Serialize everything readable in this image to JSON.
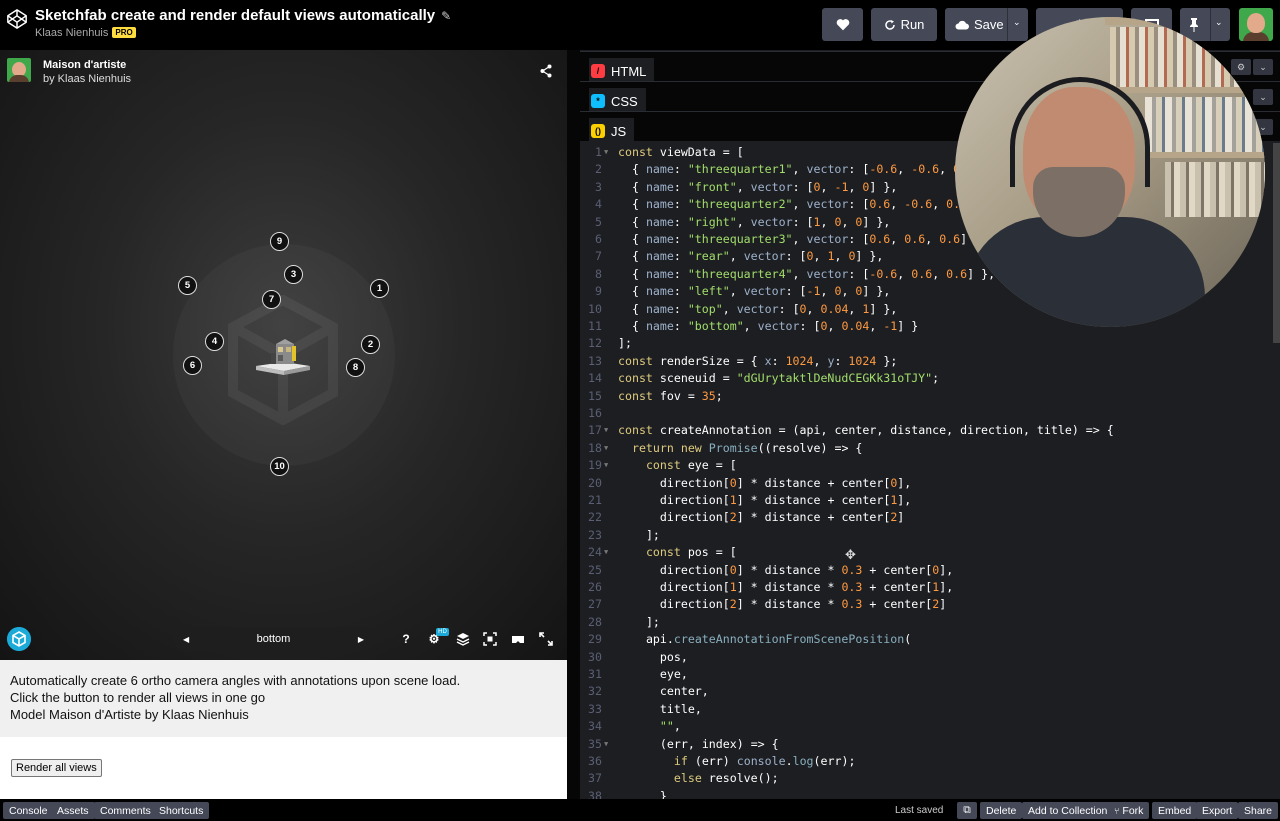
{
  "header": {
    "title": "Sketchfab create and render default views automatically",
    "author": "Klaas Nienhuis",
    "pro_badge": "PRO",
    "run_label": "Run",
    "save_label": "Save"
  },
  "viewer": {
    "model_title": "Maison d'artiste",
    "model_by": "by Klaas Nienhuis",
    "current_view": "bottom",
    "annotations": [
      "1",
      "2",
      "3",
      "4",
      "5",
      "6",
      "7",
      "8",
      "9",
      "10"
    ],
    "help_label": "?",
    "hd_badge": "HD"
  },
  "description": {
    "line1": "Automatically create 6 ortho camera angles with annotations upon scene load.",
    "line2": "Click the button to render all views in one go",
    "line3": "Model Maison d'Artiste by Klaas Nienhuis"
  },
  "render_button": "Render all views",
  "editor": {
    "tabs": [
      {
        "label": "HTML",
        "color": "#ff3c41"
      },
      {
        "label": "CSS",
        "color": "#0ebeff"
      },
      {
        "label": "JS",
        "color": "#fcd000"
      }
    ]
  },
  "code_lines": [
    "const viewData = [",
    "  { name: \"threequarter1\", vector: [-0.6, -0.6, 0.6] },",
    "  { name: \"front\", vector: [0, -1, 0] },",
    "  { name: \"threequarter2\", vector: [0.6, -0.6, 0.6] },",
    "  { name: \"right\", vector: [1, 0, 0] },",
    "  { name: \"threequarter3\", vector: [0.6, 0.6, 0.6] },",
    "  { name: \"rear\", vector: [0, 1, 0] },",
    "  { name: \"threequarter4\", vector: [-0.6, 0.6, 0.6] },",
    "  { name: \"left\", vector: [-1, 0, 0] },",
    "  { name: \"top\", vector: [0, 0.04, 1] },",
    "  { name: \"bottom\", vector: [0, 0.04, -1] }",
    "];",
    "const renderSize = { x: 1024, y: 1024 };",
    "const sceneuid = \"dGUrytaktlDeNudCEGKk31oTJY\";",
    "const fov = 35;",
    "",
    "const createAnnotation = (api, center, distance, direction, title) => {",
    "  return new Promise((resolve) => {",
    "    const eye = [",
    "      direction[0] * distance + center[0],",
    "      direction[1] * distance + center[1],",
    "      direction[2] * distance + center[2]",
    "    ];",
    "    const pos = [",
    "      direction[0] * distance * 0.3 + center[0],",
    "      direction[1] * distance * 0.3 + center[1],",
    "      direction[2] * distance * 0.3 + center[2]",
    "    ];",
    "    api.createAnnotationFromScenePosition(",
    "      pos,",
    "      eye,",
    "      center,",
    "      title,",
    "      \"\",",
    "      (err, index) => {",
    "        if (err) console.log(err);",
    "        else resolve();",
    "      }"
  ],
  "folds": [
    1,
    17,
    18,
    19,
    24,
    35
  ],
  "statusbar": {
    "console": "Console",
    "assets": "Assets",
    "comments": "Comments",
    "shortcuts": "Shortcuts",
    "last_saved": "Last saved",
    "delete": "Delete",
    "add_to_collection": "Add to Collection",
    "fork": "Fork",
    "embed": "Embed",
    "export": "Export",
    "share": "Share"
  }
}
